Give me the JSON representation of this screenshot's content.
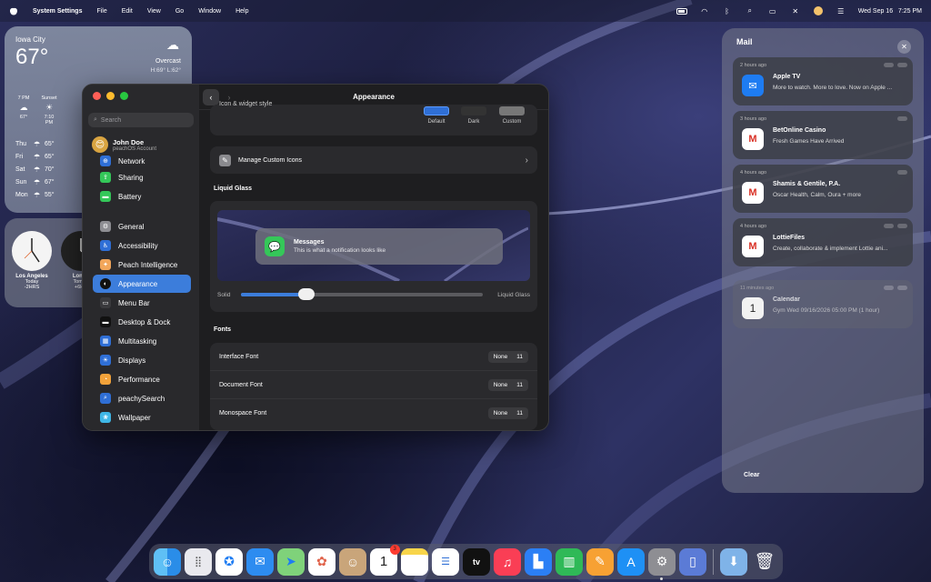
{
  "menubar": {
    "app_name": "System Settings",
    "menus": [
      "File",
      "Edit",
      "View",
      "Go",
      "Window",
      "Help"
    ],
    "datetime": "Wed Sep 16   7:25 PM"
  },
  "weather": {
    "city": "Iowa City",
    "temp": "67°",
    "condition": "Overcast",
    "high_low": "H:69° L:62°",
    "hourly": [
      {
        "time": "7 PM",
        "temp": "67°"
      },
      {
        "time": "Sunset",
        "temp": "7:10 PM"
      }
    ],
    "daily": [
      {
        "day": "Thu",
        "temp": "65°"
      },
      {
        "day": "Fri",
        "temp": "65°"
      },
      {
        "day": "Sat",
        "temp": "70°"
      },
      {
        "day": "Sun",
        "temp": "67°"
      },
      {
        "day": "Mon",
        "temp": "55°"
      }
    ]
  },
  "clocks": [
    {
      "city": "Los Angeles",
      "day": "Today",
      "offset": "-2HRS"
    },
    {
      "city": "Londo",
      "day": "Tomorr",
      "offset": "+6HR"
    }
  ],
  "settings": {
    "title": "Appearance",
    "search_placeholder": "Search",
    "account_name": "John Doe",
    "account_sub": "peachOS Account",
    "sidebar_group1": [
      "Network",
      "Sharing",
      "Battery"
    ],
    "sidebar_group2": [
      "General",
      "Accessibility",
      "Peach Intelligence",
      "Appearance",
      "Menu Bar",
      "Desktop & Dock",
      "Multitasking",
      "Displays",
      "Performance",
      "peachySearch",
      "Wallpaper"
    ],
    "icon_style_label": "Icon & widget style",
    "icon_style_options": [
      "Default",
      "Dark",
      "Custom"
    ],
    "manage_icons": "Manage Custom Icons",
    "liquid_glass_heading": "Liquid Glass",
    "preview_title": "Messages",
    "preview_body": "This is what a notification looks like",
    "slider_left": "Solid",
    "slider_right": "Liquid Glass",
    "slider_value": 0.27,
    "fonts_heading": "Fonts",
    "fonts": [
      {
        "label": "Interface Font",
        "name": "None",
        "size": "11"
      },
      {
        "label": "Document Font",
        "name": "None",
        "size": "11"
      },
      {
        "label": "Monospace Font",
        "name": "None",
        "size": "11"
      }
    ]
  },
  "mail": {
    "heading": "Mail",
    "clear": "Clear",
    "items": [
      {
        "time": "2 hours ago",
        "title": "Apple TV",
        "body": "More to watch. More to love. Now on Apple ...",
        "icon": "mail-icon",
        "color": "#1e7cf2"
      },
      {
        "time": "3 hours ago",
        "title": "BetOnline Casino",
        "body": "Fresh Games Have Arrived",
        "icon": "gmail-icon",
        "color": "#ffffff"
      },
      {
        "time": "4 hours ago",
        "title": "Shamis & Gentile, P.A.",
        "body": "Oscar Health, Calm, Oura + more",
        "icon": "gmail-icon",
        "color": "#ffffff"
      },
      {
        "time": "4 hours ago",
        "title": "LottieFiles",
        "body": "Create, collaborate & implement Lottie ani...",
        "icon": "gmail-icon",
        "color": "#ffffff"
      },
      {
        "time": "11 minutes ago",
        "title": "Calendar",
        "body": "Gym Wed 09/16/2026 05:00 PM (1 hour)",
        "icon": "calendar-icon",
        "color": "#f2f2f2"
      }
    ]
  },
  "dock": {
    "apps": [
      "Finder",
      "Launchpad",
      "Safari",
      "Mail",
      "Maps",
      "Photos",
      "Contacts",
      "Calendar",
      "Notes",
      "Reminders",
      "TV",
      "Music",
      "Keynote",
      "Numbers",
      "Pages",
      "App Store",
      "System Settings",
      "Preview"
    ],
    "calendar_date": "1",
    "calendar_badge": "3",
    "tv_label": "tv"
  }
}
